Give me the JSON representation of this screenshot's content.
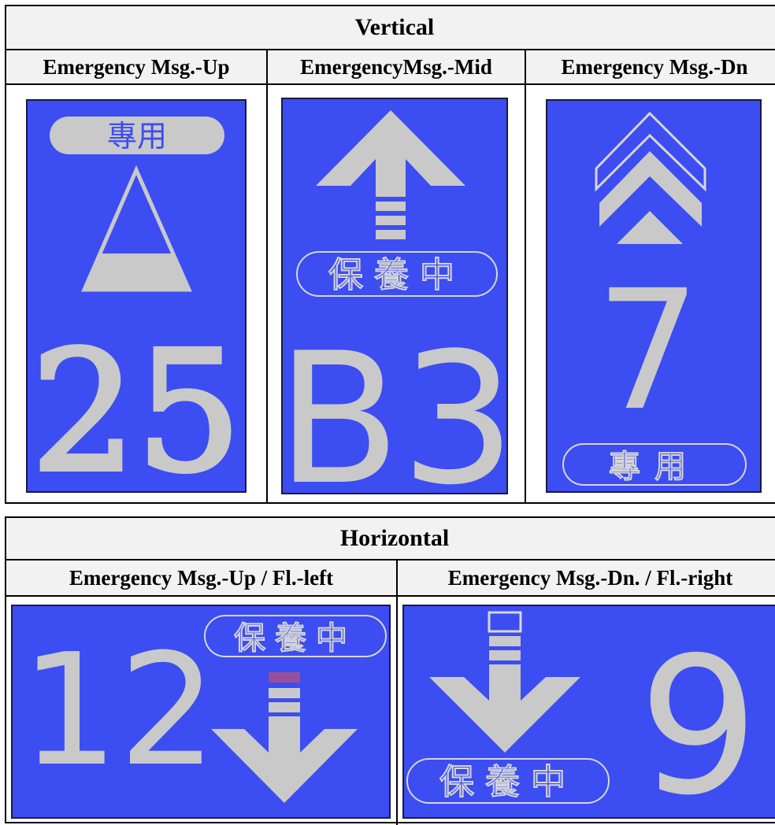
{
  "vertical": {
    "title": "Vertical",
    "columns": [
      "Emergency Msg.-Up",
      "EmergencyMsg.-Mid",
      "Emergency Msg.-Dn"
    ],
    "panels": [
      {
        "label": "專用",
        "floor": "25"
      },
      {
        "label": "保養中",
        "floor": "B3"
      },
      {
        "floor": "7",
        "label": "專用"
      }
    ]
  },
  "horizontal": {
    "title": "Horizontal",
    "columns": [
      "Emergency Msg.-Up / Fl.-left",
      "Emergency Msg.-Dn. / Fl.-right"
    ],
    "panels": [
      {
        "floor": "12",
        "label": "保養中"
      },
      {
        "label": "保養中",
        "floor": "9"
      }
    ]
  },
  "colors": {
    "screen_blue": "#3c4df2",
    "glyph_grey": "#c9c9c9",
    "header_bg": "#f2f2f2"
  },
  "icons": [
    "up-triangle-icon",
    "up-arrow-icon",
    "double-chevron-up-icon",
    "down-arrow-icon"
  ]
}
